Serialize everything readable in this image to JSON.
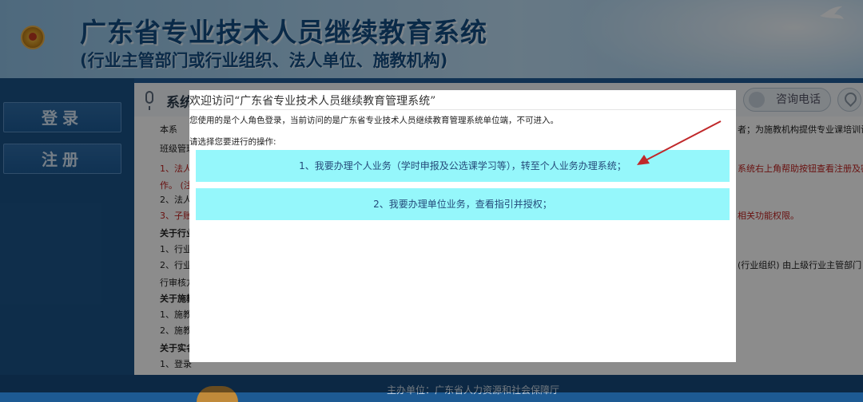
{
  "header": {
    "title": "广东省专业技术人员继续教育系统",
    "subtitle": "(行业主管部门或行业组织、法人单位、施教机构)"
  },
  "sidebar": {
    "login_label": "登录",
    "register_label": "注册"
  },
  "content": {
    "section_title": "系统",
    "tel_label": "咨询电话",
    "lines": [
      {
        "text": "本系",
        "cls": ""
      },
      {
        "text": "班级管理",
        "cls": ""
      },
      {
        "text": "1、法人",
        "cls": "red"
      },
      {
        "text": "作。 (注",
        "cls": "red"
      },
      {
        "text": "2、法人",
        "cls": ""
      },
      {
        "text": "3、子账",
        "cls": "red"
      },
      {
        "text": "关于行业",
        "cls": "bold"
      },
      {
        "text": "1、行业",
        "cls": ""
      },
      {
        "text": "2、行业",
        "cls": ""
      },
      {
        "text": "行审核方",
        "cls": ""
      },
      {
        "text": "关于施教",
        "cls": "bold"
      },
      {
        "text": "1、施教",
        "cls": ""
      },
      {
        "text": "2、施教",
        "cls": ""
      },
      {
        "text": "关于实名",
        "cls": "bold"
      },
      {
        "text": "1、登录",
        "cls": ""
      }
    ],
    "right_fragments": [
      {
        "text": "者；为施教机构提供专业课培训计划上",
        "cls": ""
      },
      {
        "text": "系统右上角帮助按钮查看注册及密码",
        "cls": "red"
      },
      {
        "text": "相关功能权限。",
        "cls": "red"
      },
      {
        "text": "(行业组织) 由上级行业主管部门 (行业",
        "cls": ""
      }
    ]
  },
  "modal": {
    "title": "欢迎访问“广东省专业技术人员继续教育管理系统”",
    "message": "您使用的是个人角色登录，当前访问的是广东省专业技术人员继续教育管理系统单位端，不可进入。",
    "prompt": "请选择您要进行的操作:",
    "option1": "1、我要办理个人业务（学时申报及公选课学习等），转至个人业务办理系统；",
    "option2": "2、我要办理单位业务，查看指引并授权；"
  },
  "footer": {
    "text": "主办单位：广东省人力资源和社会保障厅"
  },
  "colors": {
    "option_bg": "#95f7fb",
    "arrow": "#c0282a",
    "header_text": "#134d84"
  }
}
